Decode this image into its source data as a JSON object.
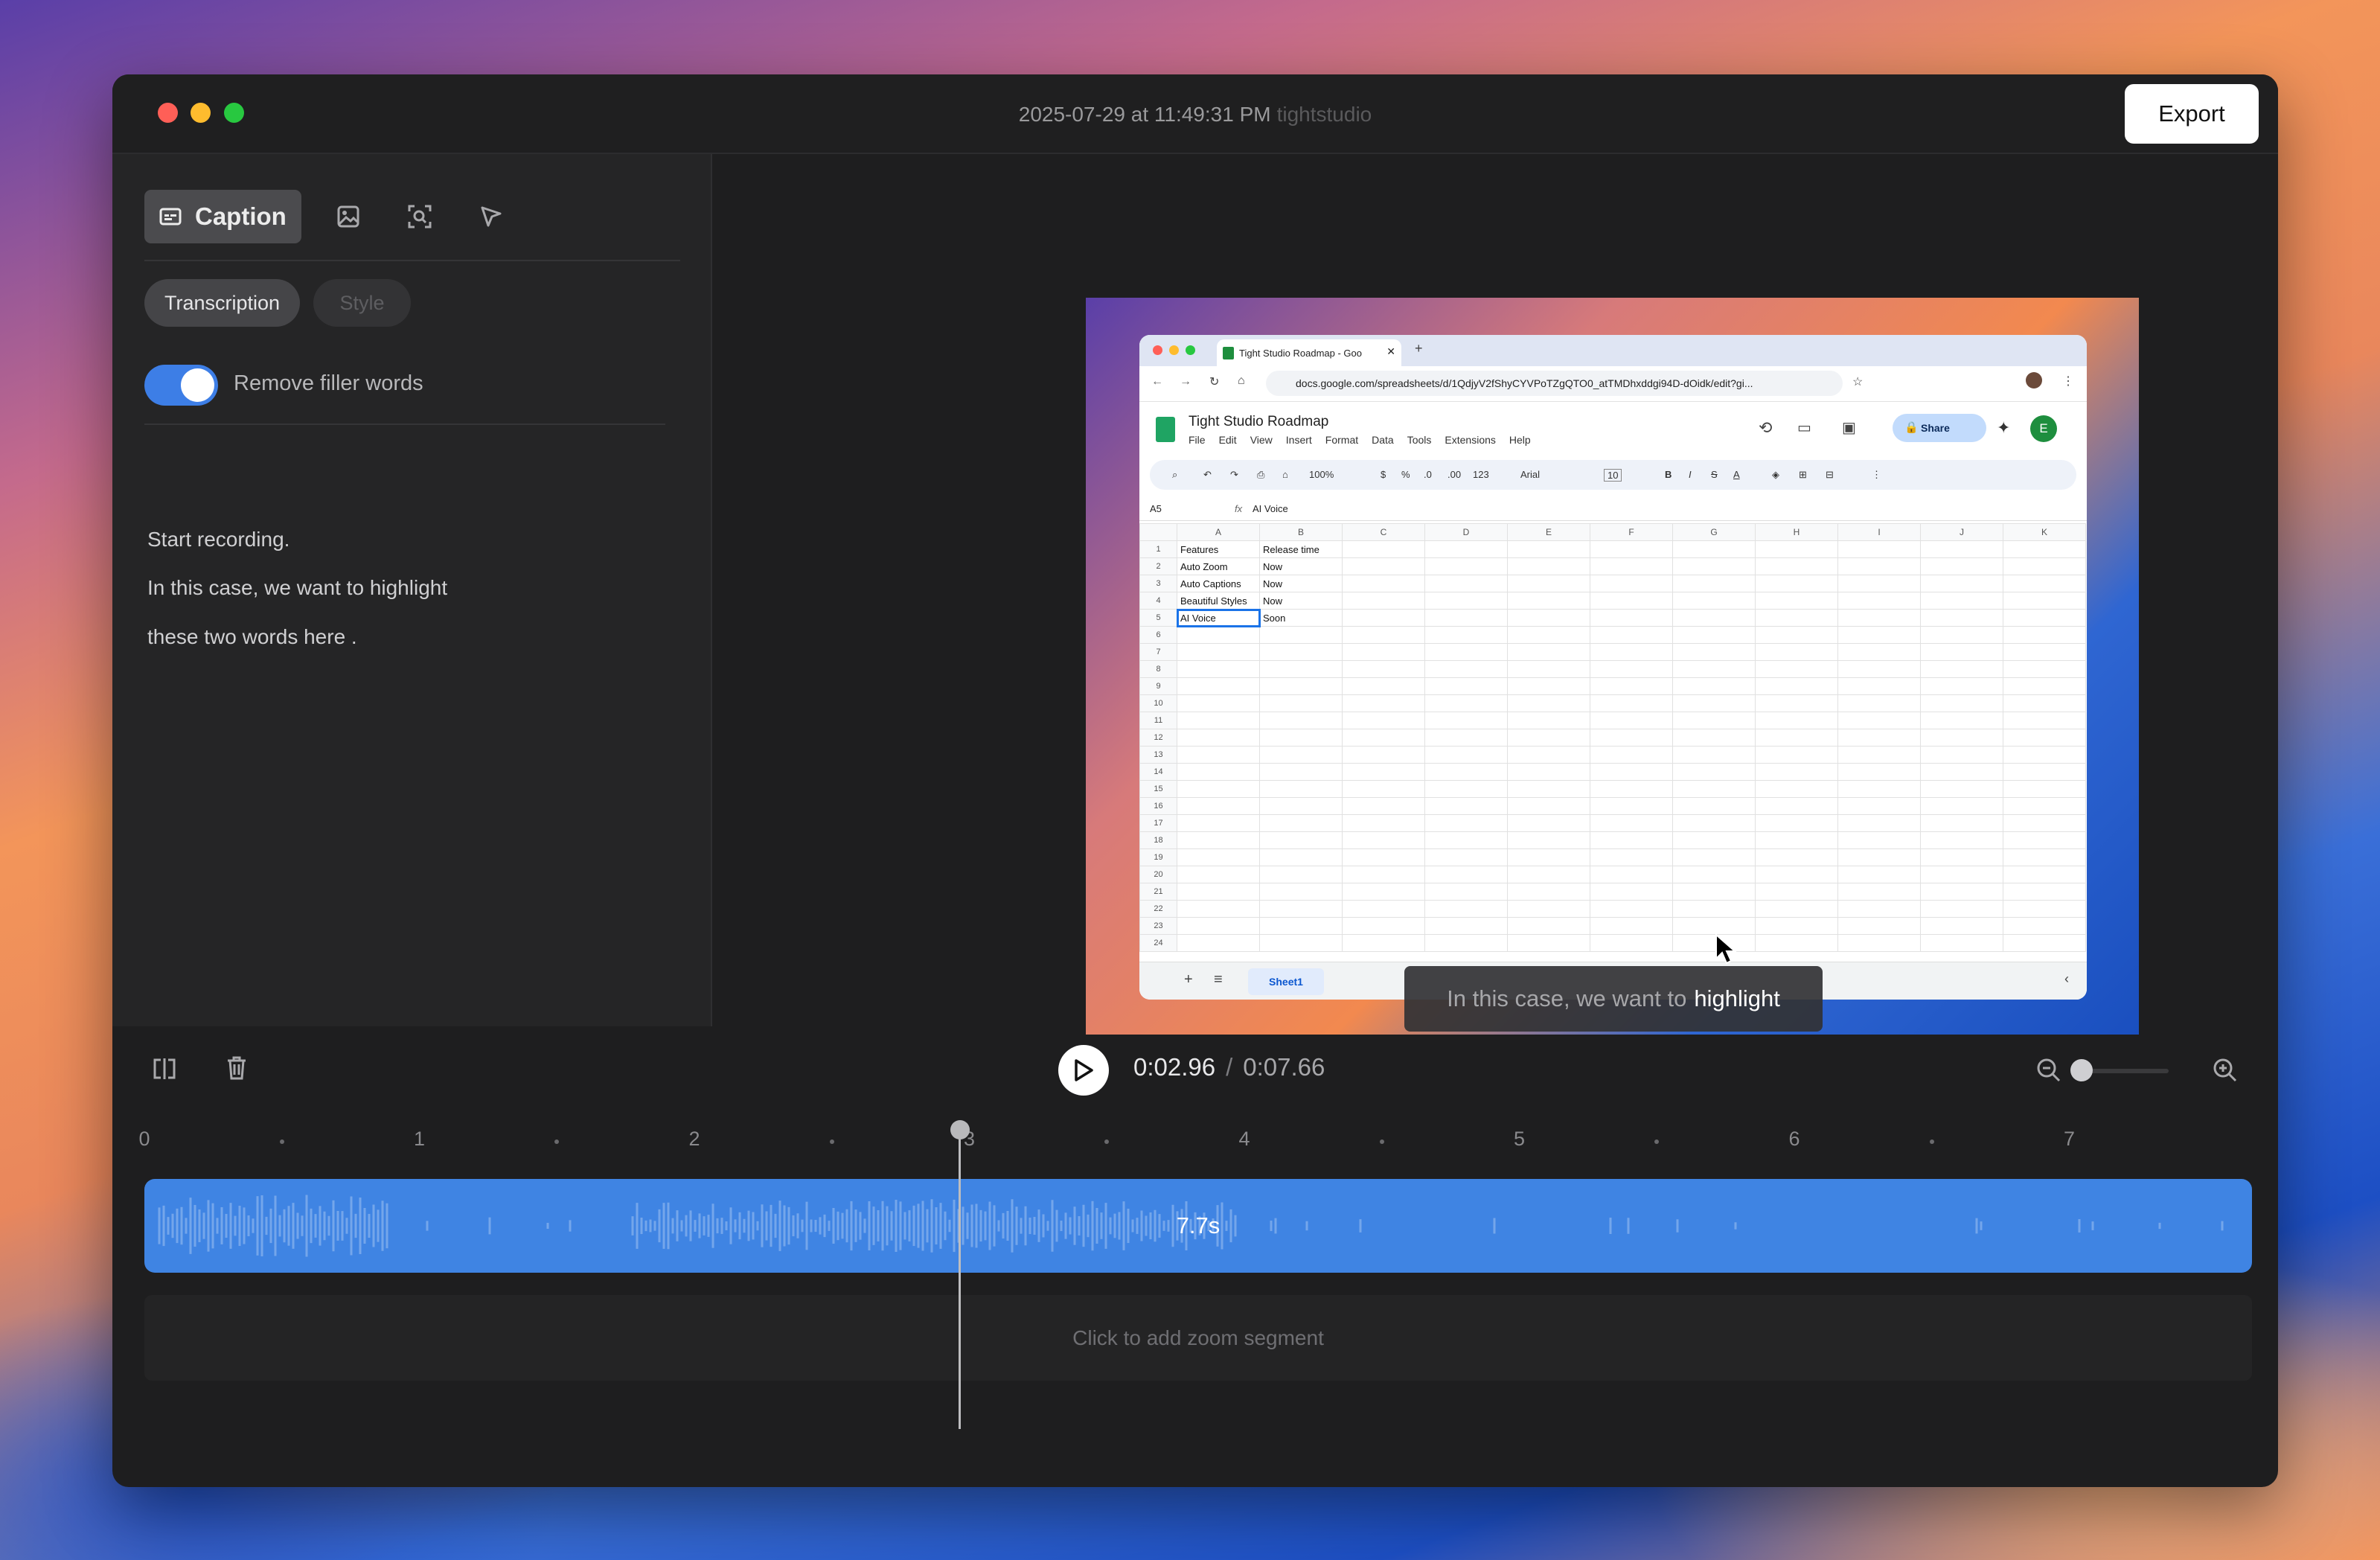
{
  "window": {
    "title_date": "2025-07-29 at 11:49:31 PM",
    "title_app": "tightstudio",
    "export_label": "Export",
    "traffic_colors": [
      "#ff5f57",
      "#febc2e",
      "#28c840"
    ]
  },
  "sidebar": {
    "tools": [
      {
        "name": "caption-icon",
        "label": "Caption",
        "active": true
      },
      {
        "name": "image-icon",
        "label": ""
      },
      {
        "name": "zoom-focus-icon",
        "label": ""
      },
      {
        "name": "cursor-icon",
        "label": ""
      }
    ],
    "segments": {
      "transcription": "Transcription",
      "style": "Style",
      "active": "transcription"
    },
    "toggle": {
      "label": "Remove filler words",
      "on": true
    },
    "transcript": [
      "Start recording.",
      "In this case, we want to highlight",
      "these two words here ."
    ]
  },
  "preview": {
    "tab_title": "Tight Studio Roadmap - Goo",
    "url": "docs.google.com/spreadsheets/d/1QdjyV2fShyCYVPoTZgQTO0_atTMDhxddgi94D-dOidk/edit?gi...",
    "doc_title": "Tight Studio Roadmap",
    "menu": [
      "File",
      "Edit",
      "View",
      "Insert",
      "Format",
      "Data",
      "Tools",
      "Extensions",
      "Help"
    ],
    "share_label": "Share",
    "avatar_letter": "E",
    "zoom": "100%",
    "font": "Arial",
    "font_size": "10",
    "fmt_symbols": {
      "currency": "$",
      "percent": "%",
      "dec_less": ".0",
      "dec_more": ".00",
      "num_format": "123"
    },
    "cell_ref": "A5",
    "formula_value": "AI Voice",
    "columns": [
      "A",
      "B",
      "C",
      "D",
      "E",
      "F",
      "G",
      "H",
      "I",
      "J",
      "K"
    ],
    "rows": [
      [
        "Features",
        "Release time"
      ],
      [
        "Auto Zoom",
        "Now"
      ],
      [
        "Auto Captions",
        "Now"
      ],
      [
        "Beautiful Styles",
        "Now"
      ],
      [
        "AI Voice",
        "Soon"
      ]
    ],
    "row_count": 24,
    "sheet_tab": "Sheet1",
    "caption_text": "In this case, we want to",
    "caption_highlight": "highlight"
  },
  "player": {
    "current_time": "0:02.96",
    "separator": "/",
    "total_time": "0:07.66",
    "zoom_level": 0.0
  },
  "timeline": {
    "ticks": [
      "0",
      "1",
      "2",
      "3",
      "4",
      "5",
      "6",
      "7"
    ],
    "playhead_seconds": 2.96,
    "clip_duration": "7.7s",
    "zoom_hint": "Click to add zoom segment"
  }
}
